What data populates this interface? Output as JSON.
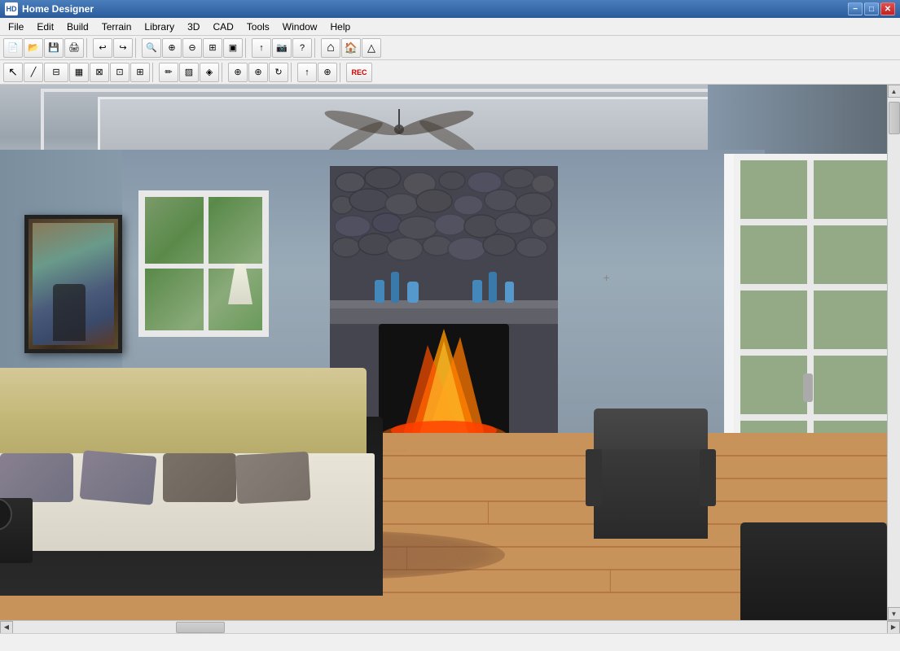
{
  "app": {
    "title": "Home Designer",
    "icon": "HD"
  },
  "titlebar": {
    "minimize_label": "−",
    "maximize_label": "□",
    "close_label": "✕"
  },
  "menubar": {
    "items": [
      {
        "id": "file",
        "label": "File"
      },
      {
        "id": "edit",
        "label": "Edit"
      },
      {
        "id": "build",
        "label": "Build"
      },
      {
        "id": "terrain",
        "label": "Terrain"
      },
      {
        "id": "library",
        "label": "Library"
      },
      {
        "id": "3d",
        "label": "3D"
      },
      {
        "id": "cad",
        "label": "CAD"
      },
      {
        "id": "tools",
        "label": "Tools"
      },
      {
        "id": "window",
        "label": "Window"
      },
      {
        "id": "help",
        "label": "Help"
      }
    ]
  },
  "toolbar1": {
    "buttons": [
      {
        "id": "new",
        "icon": "📄"
      },
      {
        "id": "open",
        "icon": "📂"
      },
      {
        "id": "save",
        "icon": "💾"
      },
      {
        "id": "print",
        "icon": "🖨"
      },
      {
        "id": "undo",
        "icon": "↩"
      },
      {
        "id": "redo",
        "icon": "↪"
      },
      {
        "id": "zoom-out-w",
        "icon": "🔍"
      },
      {
        "id": "zoom-in",
        "icon": "⊕"
      },
      {
        "id": "zoom-out",
        "icon": "⊖"
      },
      {
        "id": "fit",
        "icon": "⊞"
      },
      {
        "id": "real-size",
        "icon": "▣"
      },
      {
        "id": "arrow-up",
        "icon": "↑"
      },
      {
        "id": "camera",
        "icon": "📷"
      },
      {
        "id": "help-q",
        "icon": "?"
      },
      {
        "id": "home1",
        "icon": "🏠"
      },
      {
        "id": "home2",
        "icon": "⌂"
      },
      {
        "id": "home3",
        "icon": "△"
      }
    ]
  },
  "toolbar2": {
    "buttons": [
      {
        "id": "select",
        "icon": "↖"
      },
      {
        "id": "draw-line",
        "icon": "╱"
      },
      {
        "id": "draw-wall",
        "icon": "⊟"
      },
      {
        "id": "room",
        "icon": "▦"
      },
      {
        "id": "stair",
        "icon": "⊠"
      },
      {
        "id": "door",
        "icon": "⊡"
      },
      {
        "id": "window-tool",
        "icon": "⊞"
      },
      {
        "id": "paint",
        "icon": "✏"
      },
      {
        "id": "texture",
        "icon": "▨"
      },
      {
        "id": "material",
        "icon": "◈"
      },
      {
        "id": "place",
        "icon": "⊕"
      },
      {
        "id": "arrow-tool",
        "icon": "↑"
      },
      {
        "id": "move",
        "icon": "⊕"
      },
      {
        "id": "rec",
        "icon": "REC"
      }
    ]
  },
  "statusbar": {
    "text": ""
  },
  "scene": {
    "description": "3D bedroom interior render with fireplace, bed, armchair, and windows"
  }
}
